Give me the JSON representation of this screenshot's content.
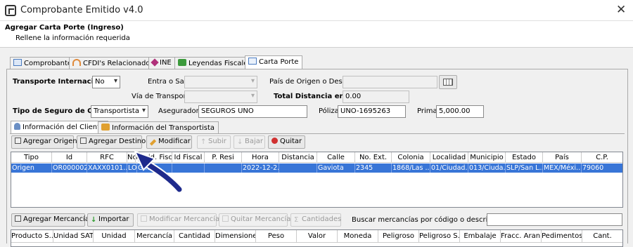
{
  "window": {
    "title": "Comprobante Emitido v4.0",
    "close": "✕"
  },
  "header": {
    "title": "Agregar Carta Porte (Ingreso)",
    "subtitle": "Rellene la información requerida"
  },
  "tabs": [
    {
      "label": "Comprobante"
    },
    {
      "label": "CFDI's Relacionados"
    },
    {
      "label": "INE"
    },
    {
      "label": "Leyendas Fiscales"
    },
    {
      "label": "Carta Porte"
    }
  ],
  "form": {
    "transporte_internacional": {
      "label": "Transporte Internacional",
      "value": "No"
    },
    "entra_sale": {
      "label": "Entra o Sale",
      "value": ""
    },
    "pais_origen": {
      "label": "País de Origen o Destino",
      "value": ""
    },
    "via_transporte": {
      "label": "Vía de Transporte",
      "value": ""
    },
    "total_distancia": {
      "label": "Total Distancia en KM",
      "value": "0.00"
    },
    "tipo_seguro": {
      "label": "Tipo de Seguro de Carga",
      "value": "Transportista"
    },
    "aseguradora": {
      "label": "Aseguradora",
      "value": "SEGUROS UNO"
    },
    "poliza": {
      "label": "Póliza",
      "value": "UNO-1695263"
    },
    "prima": {
      "label": "Prima",
      "value": "5,000.00"
    }
  },
  "subtabs": [
    {
      "label": "Información del Cliente"
    },
    {
      "label": "Información del Transportista"
    }
  ],
  "toolbar": {
    "agregar_origen": "Agregar Origen",
    "agregar_destino": "Agregar Destino",
    "modificar": "Modificar",
    "subir": "Subir",
    "bajar": "Bajar",
    "quitar": "Quitar"
  },
  "ubicaciones": {
    "columns": [
      "Tipo",
      "Id",
      "RFC",
      "Nombre",
      "Resid. Fiscal",
      "Id Fiscal",
      "P. Resi",
      "Hora",
      "Distancia",
      "Calle",
      "No. Ext.",
      "Colonia",
      "Localidad",
      "Municipio",
      "Estado",
      "País",
      "C.P."
    ],
    "rows": [
      [
        "Origen",
        "OR000002",
        "XAXX0101...",
        "LO...",
        "G...",
        "",
        "",
        "2022-12-2...",
        "",
        "Gaviota",
        "2345",
        "1868/Las ...",
        "01/Ciudad...",
        "013/Ciuda...",
        "SLP/San L...",
        "MEX/Méxi...",
        "79060"
      ]
    ]
  },
  "mercancias_toolbar": {
    "agregar": "Agregar Mercancía",
    "importar": "Importar",
    "modificar": "Modificar Mercancía",
    "quitar": "Quitar Mercancía",
    "cantidades": "Cantidades",
    "buscar_label": "Buscar mercancías por código o descripción:",
    "buscar_value": ""
  },
  "mercancias": {
    "columns": [
      "Producto S...",
      "Unidad SAT",
      "Unidad",
      "Mercancía",
      "Cantidad",
      "Dimensiones",
      "Peso",
      "Valor",
      "Moneda",
      "Peligroso",
      "Peligroso S...",
      "Embalaje",
      "Fracc. Aran.",
      "Pedimentos",
      "Cant."
    ]
  },
  "colors": {
    "selection": "#3875d7",
    "arrow": "#1e2a8c"
  }
}
